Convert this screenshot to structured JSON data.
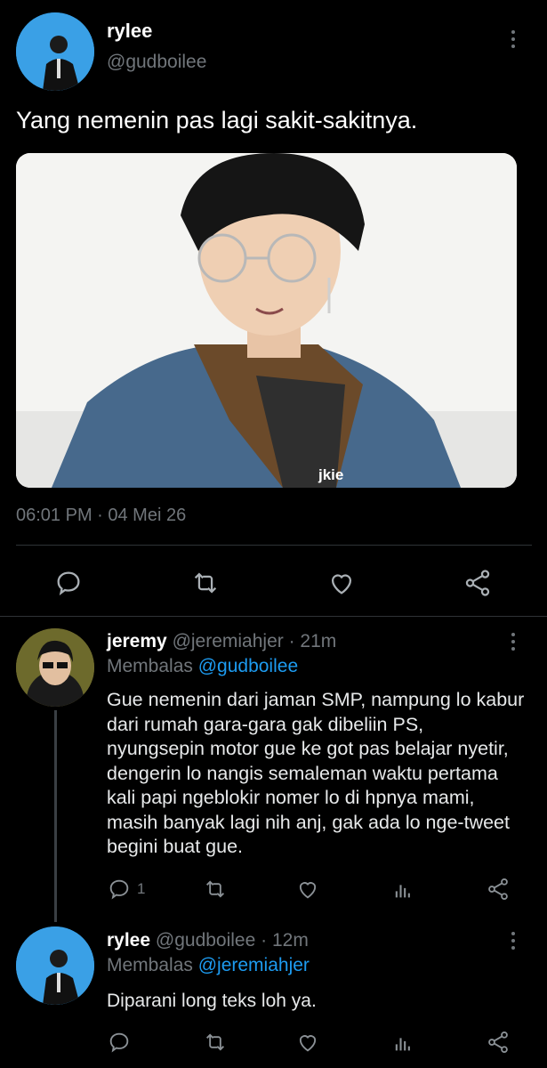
{
  "main_tweet": {
    "display_name": "rylee",
    "handle": "@gudboilee",
    "text": "Yang nemenin pas lagi sakit-sakitnya.",
    "image_watermark": "jkie",
    "timestamp": "06:01 PM · 04 Mei 26"
  },
  "reply1": {
    "display_name": "jeremy",
    "handle": "@jeremiahjer",
    "time": "· 21m",
    "replying_prefix": "Membalas",
    "replying_to": "@gudboilee",
    "text": "Gue nemenin dari jaman SMP, nampung lo kabur dari rumah gara-gara gak dibeliin PS, nyungsepin motor gue ke got pas belajar nyetir, dengerin lo nangis semaleman waktu pertama kali papi ngeblokir nomer lo di hpnya mami, masih banyak lagi nih anj, gak ada lo nge-tweet begini buat gue.",
    "reply_count": "1"
  },
  "reply2": {
    "display_name": "rylee",
    "handle": "@gudboilee",
    "time": "· 12m",
    "replying_prefix": "Membalas",
    "replying_to": "@jeremiahjer",
    "text": "Diparani long teks loh ya."
  },
  "colors": {
    "background": "#000000",
    "accent": "#1d9bf0",
    "muted": "#71767b",
    "divider": "#2f3336"
  },
  "icons": [
    "reply-icon",
    "retweet-icon",
    "like-icon",
    "share-icon",
    "analytics-icon",
    "more-icon"
  ]
}
